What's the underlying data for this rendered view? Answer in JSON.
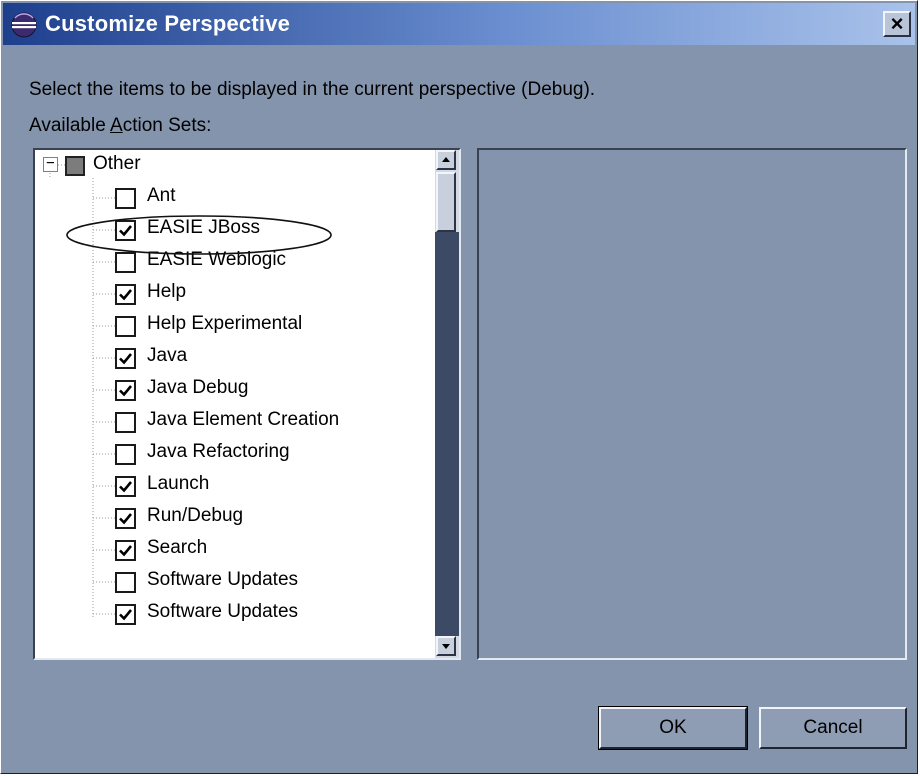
{
  "window": {
    "title": "Customize Perspective",
    "close_label": "×"
  },
  "instruction_text": "Select the items to be displayed in the current perspective (Debug).",
  "available_label_pre": "Available ",
  "available_label_accel": "A",
  "available_label_post": "ction Sets:",
  "tree": {
    "category": {
      "label": "Other",
      "expander": "−",
      "expanded": true
    },
    "items": [
      {
        "label": "Ant",
        "checked": false
      },
      {
        "label": "EASIE JBoss",
        "checked": true,
        "highlighted": true
      },
      {
        "label": "EASIE Weblogic",
        "checked": false
      },
      {
        "label": "Help",
        "checked": true
      },
      {
        "label": "Help Experimental",
        "checked": false
      },
      {
        "label": "Java",
        "checked": true
      },
      {
        "label": "Java Debug",
        "checked": true
      },
      {
        "label": "Java Element Creation",
        "checked": false
      },
      {
        "label": "Java Refactoring",
        "checked": false
      },
      {
        "label": "Launch",
        "checked": true
      },
      {
        "label": "Run/Debug",
        "checked": true
      },
      {
        "label": "Search",
        "checked": true
      },
      {
        "label": "Software Updates",
        "checked": false
      },
      {
        "label": "Software Updates",
        "checked": true
      }
    ]
  },
  "buttons": {
    "ok": "OK",
    "cancel": "Cancel"
  },
  "colors": {
    "dialog_bg": "#8494ad",
    "title_gradient_start": "#1e3f8c",
    "title_gradient_end": "#a9c2ea",
    "scroll_track": "#3d4a65"
  }
}
